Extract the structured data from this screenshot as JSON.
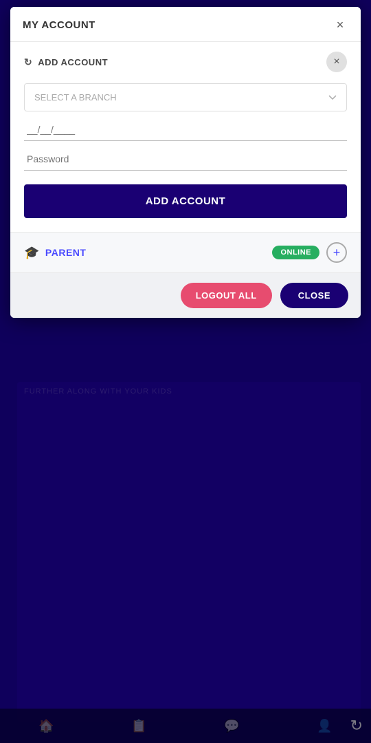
{
  "modal": {
    "title": "MY ACCOUNT",
    "close_x_label": "×",
    "add_account_section": {
      "label": "ADD ACCOUNT",
      "refresh_icon": "↻",
      "close_circle_label": "×",
      "select_placeholder": "SELECT A BRANCH",
      "date_placeholder": "__/__/____",
      "password_placeholder": "Password",
      "add_button_label": "ADD ACCOUNT"
    },
    "accounts": [
      {
        "icon": "🎓",
        "name": "PARENT",
        "status": "ONLINE",
        "status_color": "#27ae60"
      }
    ],
    "footer": {
      "logout_all_label": "LOGOUT ALL",
      "close_label": "CLOSE"
    }
  },
  "background": {
    "promo_text": "FURTHER ALONG WITH YOUR KIDS",
    "refresh_icon": "↻"
  },
  "bottom_nav": {
    "icons": [
      "🏠",
      "📋",
      "💬",
      "👤"
    ]
  }
}
